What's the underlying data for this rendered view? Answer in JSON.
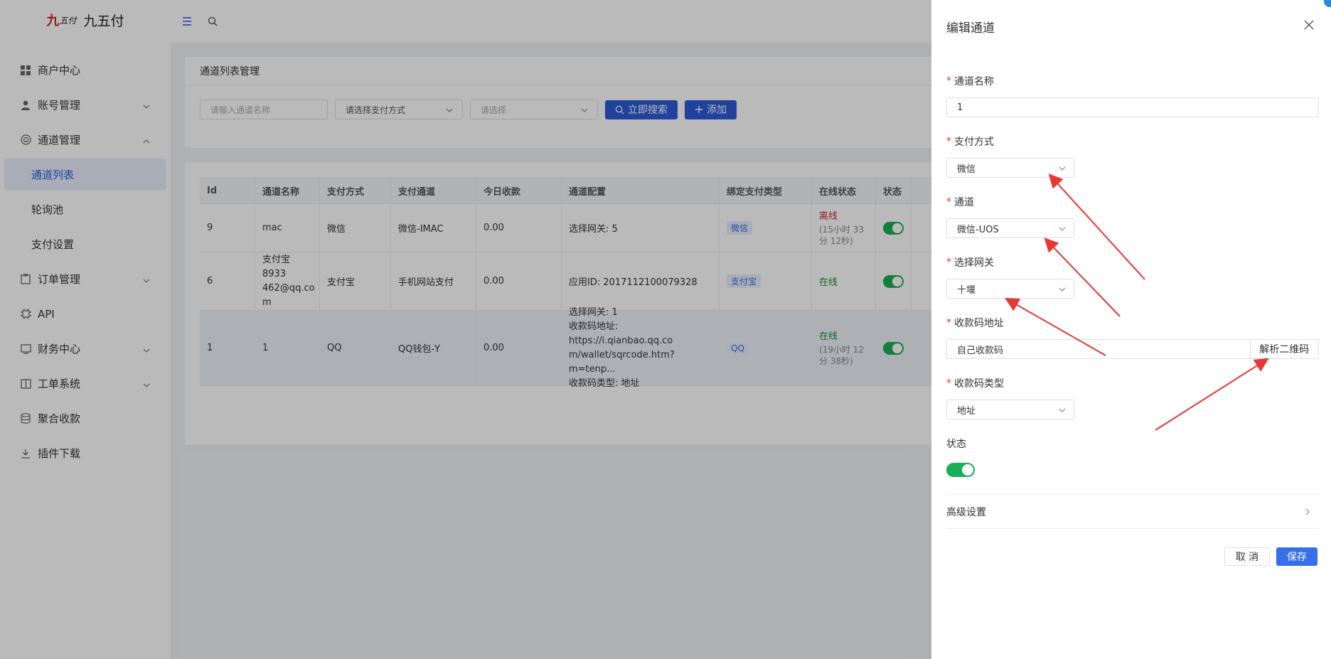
{
  "brand": {
    "logo_mark_a": "九",
    "logo_mark_b": "五付",
    "name": "九五付"
  },
  "sidebar": {
    "items": [
      {
        "label": "商户中心",
        "icon": "grid-icon"
      },
      {
        "label": "账号管理",
        "icon": "user-icon"
      },
      {
        "label": "通道管理",
        "icon": "channel-icon"
      },
      {
        "label": "通道列表"
      },
      {
        "label": "轮询池"
      },
      {
        "label": "支付设置"
      },
      {
        "label": "订单管理",
        "icon": "clipboard-icon"
      },
      {
        "label": "API",
        "icon": "chip-icon"
      },
      {
        "label": "财务中心",
        "icon": "finance-icon"
      },
      {
        "label": "工单系统",
        "icon": "book-icon"
      },
      {
        "label": "聚合收款",
        "icon": "stack-icon"
      },
      {
        "label": "插件下载",
        "icon": "download-icon"
      }
    ]
  },
  "main": {
    "title": "通道列表管理",
    "filters": {
      "name_placeholder": "请输入通道名称",
      "pay_method_placeholder": "请选择支付方式",
      "select_placeholder": "请选择",
      "search_label": "立即搜索",
      "add_label": "添加"
    },
    "table": {
      "headers": [
        "Id",
        "通道名称",
        "支付方式",
        "支付通道",
        "今日收款",
        "通道配置",
        "绑定支付类型",
        "在线状态",
        "状态"
      ],
      "rows": [
        {
          "id": "9",
          "name": [
            "mac"
          ],
          "method": "微信",
          "channel": "微信-IMAC",
          "today": "0.00",
          "config": [
            "选择网关: 5"
          ],
          "bind": "微信",
          "status": "离线",
          "status_sub": "(15小时 33分 12秒)",
          "online": false
        },
        {
          "id": "6",
          "name": [
            "支付宝8933",
            "462@qq.co",
            "m"
          ],
          "method": "支付宝",
          "channel": "手机网站支付",
          "today": "0.00",
          "config": [
            "应用ID: 2017112100079328"
          ],
          "bind": "支付宝",
          "status": "在线",
          "status_sub": "",
          "online": true
        },
        {
          "id": "1",
          "name": [
            "1"
          ],
          "method": "QQ",
          "channel": "QQ钱包-Y",
          "today": "0.00",
          "config": [
            "选择网关: 1",
            "收款码地址: https://i.qianbao.qq.co",
            "m/wallet/sqrcode.htm?m=tenp...",
            "收款码类型: 地址"
          ],
          "bind": "QQ",
          "status": "在线",
          "status_sub": "(19小时 12分 38秒)",
          "online": true
        }
      ]
    }
  },
  "drawer": {
    "title": "编辑通道",
    "fields": {
      "channel_name": {
        "label": "通道名称",
        "value": "1"
      },
      "pay_method": {
        "label": "支付方式",
        "value": "微信"
      },
      "channel": {
        "label": "通道",
        "value": "微信-UOS"
      },
      "gateway": {
        "label": "选择网关",
        "value": "十堰"
      },
      "qr_address": {
        "label": "收款码地址",
        "value": "自己收款码",
        "button": "解析二维码"
      },
      "qr_type": {
        "label": "收款码类型",
        "value": "地址"
      },
      "status": {
        "label": "状态",
        "on": true
      }
    },
    "advanced": "高级设置",
    "cancel": "取 消",
    "save": "保存"
  },
  "colors": {
    "primary": "#2c5bd8",
    "save": "#3670e8",
    "switch_on": "#1aae55",
    "offline": "#c62828",
    "online": "#1a8a3a",
    "annotation": "#e53935"
  }
}
